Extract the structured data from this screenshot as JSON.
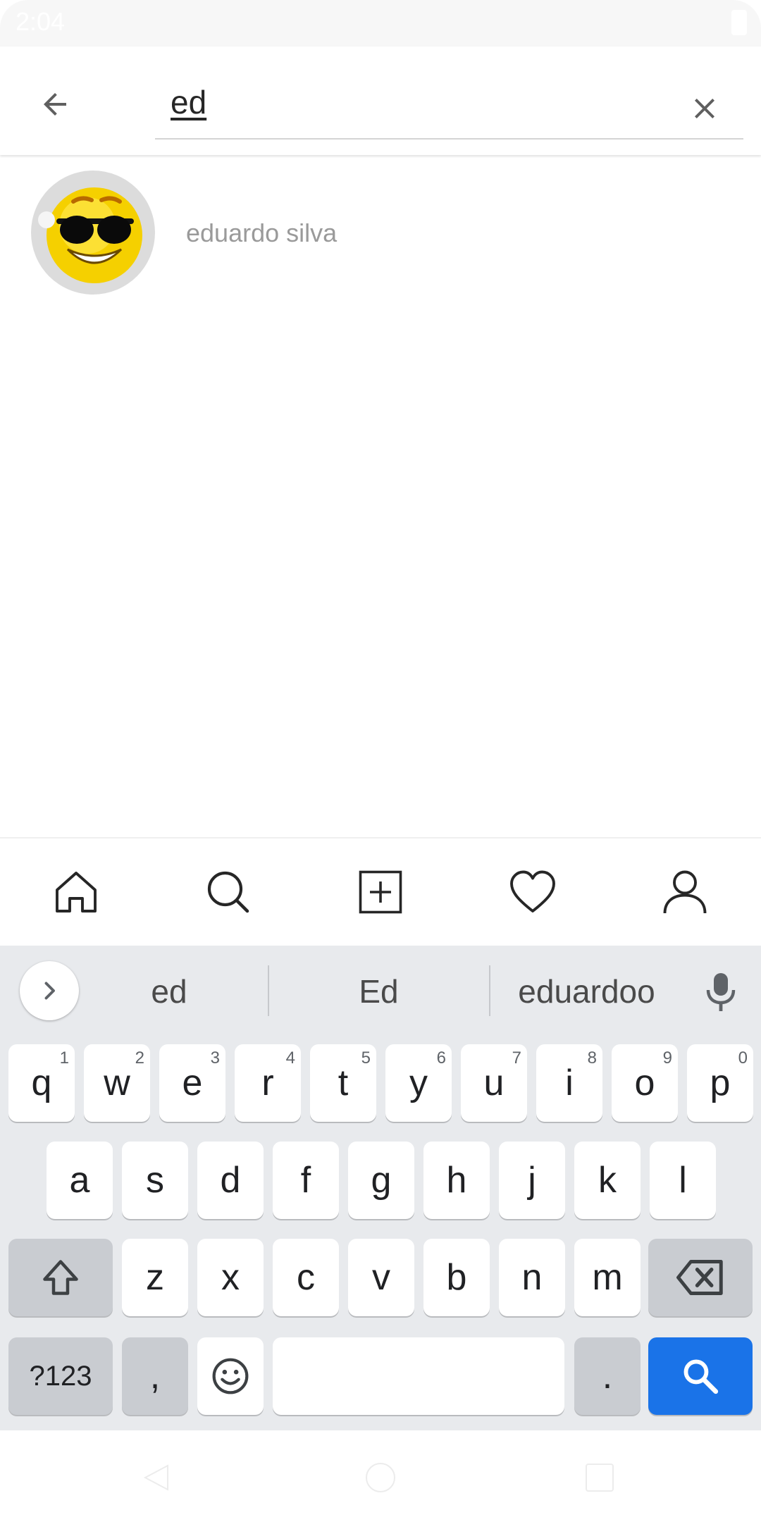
{
  "status": {
    "time": "2:04"
  },
  "search": {
    "query": "ed"
  },
  "results": [
    {
      "name": "eduardo silva"
    }
  ],
  "keyboard": {
    "suggestions": [
      "ed",
      "Ed",
      "eduardoo"
    ],
    "row1": [
      {
        "key": "q",
        "hint": "1"
      },
      {
        "key": "w",
        "hint": "2"
      },
      {
        "key": "e",
        "hint": "3"
      },
      {
        "key": "r",
        "hint": "4"
      },
      {
        "key": "t",
        "hint": "5"
      },
      {
        "key": "y",
        "hint": "6"
      },
      {
        "key": "u",
        "hint": "7"
      },
      {
        "key": "i",
        "hint": "8"
      },
      {
        "key": "o",
        "hint": "9"
      },
      {
        "key": "p",
        "hint": "0"
      }
    ],
    "row2": [
      "a",
      "s",
      "d",
      "f",
      "g",
      "h",
      "j",
      "k",
      "l"
    ],
    "row3": [
      "z",
      "x",
      "c",
      "v",
      "b",
      "n",
      "m"
    ],
    "symbols_label": "?123",
    "comma": ",",
    "period": ".",
    "accent_color": "#1a73e8"
  }
}
